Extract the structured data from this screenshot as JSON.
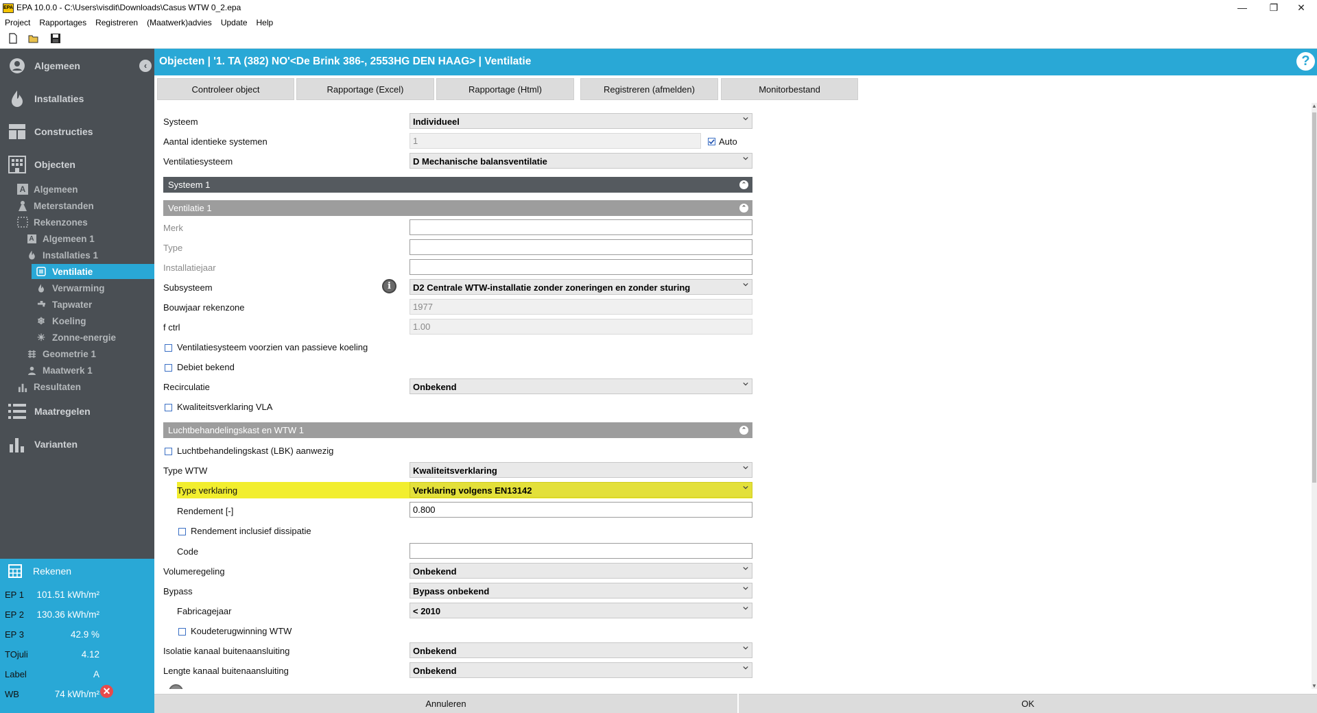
{
  "window": {
    "title": "EPA 10.0.0 - C:\\Users\\visdit\\Downloads\\Casus WTW 0_2.epa",
    "app_icon_text": "EPA",
    "minimize": "—",
    "restore": "❐",
    "close": "✕"
  },
  "menu": [
    "Project",
    "Rapportages",
    "Registreren",
    "(Maatwerk)advies",
    "Update",
    "Help"
  ],
  "sidebar": {
    "main": {
      "algemeen": "Algemeen",
      "installaties": "Installaties",
      "constructies": "Constructies",
      "objecten": "Objecten",
      "maatregelen": "Maatregelen",
      "varianten": "Varianten"
    },
    "sub": {
      "algemeen": "Algemeen",
      "meterstanden": "Meterstanden",
      "rekenzones": "Rekenzones",
      "algemeen1": "Algemeen 1",
      "installaties1": "Installaties 1",
      "ventilatie": "Ventilatie",
      "verwarming": "Verwarming",
      "tapwater": "Tapwater",
      "koeling": "Koeling",
      "zonne_energie": "Zonne-energie",
      "geometrie1": "Geometrie 1",
      "maatwerk1": "Maatwerk 1",
      "resultaten": "Resultaten"
    }
  },
  "results": {
    "rekenen": "Rekenen",
    "rows": [
      {
        "label": "EP 1",
        "value": "101.51 kWh/m²"
      },
      {
        "label": "EP 2",
        "value": "130.36 kWh/m²"
      },
      {
        "label": "EP 3",
        "value": "42.9 %"
      },
      {
        "label": "TOjuli",
        "value": "4.12"
      },
      {
        "label": "Label",
        "value": "A"
      },
      {
        "label": "WB",
        "value": "74 kWh/m²"
      }
    ]
  },
  "header": {
    "title": "Objecten | '1. TA (382) NO'<De Brink 386-, 2553HG DEN HAAG> | Ventilatie",
    "help": "?"
  },
  "actions": {
    "controleer": "Controleer object",
    "rap_excel": "Rapportage (Excel)",
    "rap_html": "Rapportage (Html)",
    "registreren": "Registreren (afmelden)",
    "monitor": "Monitorbestand"
  },
  "form": {
    "systeem": {
      "label": "Systeem",
      "value": "Individueel"
    },
    "aantal": {
      "label": "Aantal identieke systemen",
      "value": "1",
      "auto_label": "Auto"
    },
    "ventilatiesysteem": {
      "label": "Ventilatiesysteem",
      "value": "D Mechanische balansventilatie"
    },
    "section_systeem": "Systeem 1",
    "section_ventilatie": "Ventilatie 1",
    "merk": {
      "label": "Merk",
      "value": ""
    },
    "type": {
      "label": "Type",
      "value": ""
    },
    "installatiejaar": {
      "label": "Installatiejaar",
      "value": ""
    },
    "subsysteem": {
      "label": "Subsysteem",
      "value": "D2 Centrale WTW-installatie zonder zoneringen en zonder sturing"
    },
    "bouwjaar": {
      "label": "Bouwjaar rekenzone",
      "value": "1977"
    },
    "fctrl": {
      "label": "f ctrl",
      "value": "1.00"
    },
    "passieve_koeling": "Ventilatiesysteem voorzien van passieve koeling",
    "debiet": "Debiet bekend",
    "recirculatie": {
      "label": "Recirculatie",
      "value": "Onbekend"
    },
    "kwaliteit_vla": "Kwaliteitsverklaring VLA",
    "section_lbk": "Luchtbehandelingskast en WTW 1",
    "lbk_aanwezig": "Luchtbehandelingskast (LBK) aanwezig",
    "type_wtw": {
      "label": "Type WTW",
      "value": "Kwaliteitsverklaring"
    },
    "type_verklaring": {
      "label": "Type verklaring",
      "value": "Verklaring volgens EN13142"
    },
    "rendement": {
      "label": "Rendement [-]",
      "value": "0.800"
    },
    "rendement_dissipatie": "Rendement inclusief dissipatie",
    "code": {
      "label": "Code",
      "value": ""
    },
    "volumeregeling": {
      "label": "Volumeregeling",
      "value": "Onbekend"
    },
    "bypass": {
      "label": "Bypass",
      "value": "Bypass onbekend"
    },
    "fabricagejaar": {
      "label": "Fabricagejaar",
      "value": "< 2010"
    },
    "koudeterugwinning": "Koudeterugwinning WTW",
    "isolatie": {
      "label": "Isolatie kanaal buitenaansluiting",
      "value": "Onbekend"
    },
    "lengte": {
      "label": "Lengte kanaal buitenaansluiting",
      "value": "Onbekend"
    }
  },
  "bottom": {
    "annuleren": "Annuleren",
    "ok": "OK"
  },
  "colors": {
    "accent": "#29a8d6",
    "sidebar": "#4a4f54",
    "highlight": "#f2ee2e",
    "error": "#e84a4a"
  }
}
